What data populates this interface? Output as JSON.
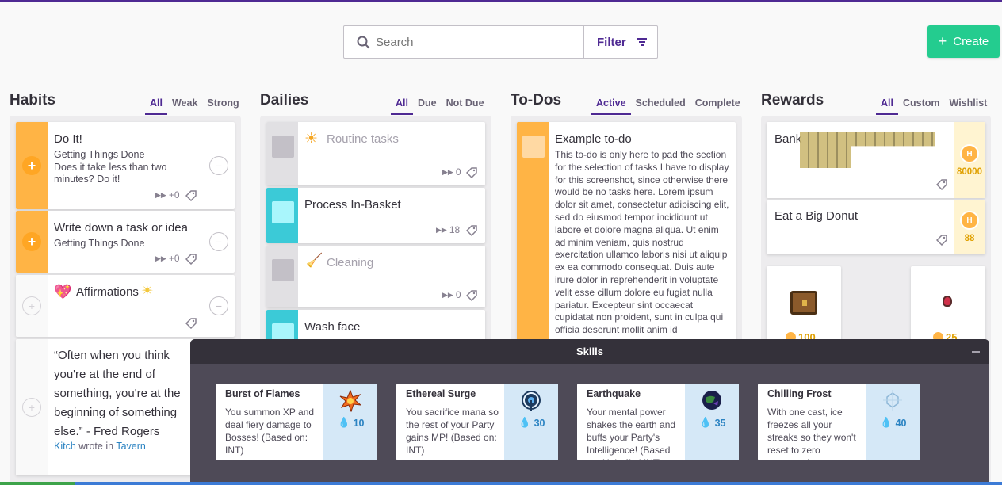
{
  "search": {
    "placeholder": "Search"
  },
  "filter": {
    "label": "Filter"
  },
  "create": {
    "label": "Create"
  },
  "habits": {
    "title": "Habits",
    "tabs": [
      "All",
      "Weak",
      "Strong"
    ],
    "tasks": [
      {
        "title": "Do It!",
        "notes": "Getting Things Done\nDoes it take less than two minutes? Do it!",
        "counter": "+0"
      },
      {
        "title": "Write down a task or idea",
        "notes": "Getting Things Done",
        "counter": "+0"
      },
      {
        "title": "Affirmations",
        "notes": "",
        "counter": ""
      },
      {
        "title": "“Often when you think you're at the end of something, you're at the beginning of something else.” - Fred Rogers",
        "author": "Kitch",
        "wrote_in": "wrote in",
        "location": "Tavern"
      }
    ]
  },
  "dailies": {
    "title": "Dailies",
    "tabs": [
      "All",
      "Due",
      "Not Due"
    ],
    "tasks": [
      {
        "title": "Routine tasks",
        "streak": "0"
      },
      {
        "title": "Process In-Basket",
        "streak": "18"
      },
      {
        "title": "Cleaning",
        "streak": "0"
      },
      {
        "title": "Wash face",
        "streak": ""
      }
    ]
  },
  "todos": {
    "title": "To-Dos",
    "tabs": [
      "Active",
      "Scheduled",
      "Complete"
    ],
    "tasks": [
      {
        "title": "Example to-do",
        "notes": "This to-do is only here to pad the section for the selection of tasks I have to display for this screenshot, since otherwise there would be no tasks here. Lorem ipsum dolor sit amet, consectetur adipiscing elit, sed do eiusmod tempor incididunt ut labore et dolore magna aliqua. Ut enim ad minim veniam, quis nostrud exercitation ullamco laboris nisi ut aliquip ex ea commodo consequat. Duis aute irure dolor in reprehenderit in voluptate velit esse cillum dolore eu fugiat nulla pariatur. Excepteur sint occaecat cupidatat non proident, sunt in culpa qui officia deserunt mollit anim id"
      }
    ]
  },
  "rewards": {
    "title": "Rewards",
    "tabs": [
      "All",
      "Custom",
      "Wishlist"
    ],
    "custom": [
      {
        "title": "Bank",
        "cost": "80000"
      },
      {
        "title": "Eat a Big Donut",
        "cost": "88"
      }
    ],
    "items": [
      {
        "name": "treasure-chest",
        "cost": "100"
      },
      {
        "name": "health-potion",
        "cost": "25"
      }
    ]
  },
  "skills": {
    "title": "Skills",
    "list": [
      {
        "name": "Burst of Flames",
        "desc": "You summon XP and deal fiery damage to Bosses! (Based on: INT)",
        "cost": "10"
      },
      {
        "name": "Ethereal Surge",
        "desc": "You sacrifice mana so the rest of your Party gains MP! (Based on: INT)",
        "cost": "30"
      },
      {
        "name": "Earthquake",
        "desc": "Your mental power shakes the earth and buffs your Party's Intelligence! (Based on: Unbuffed INT)",
        "cost": "35"
      },
      {
        "name": "Chilling Frost",
        "desc": "With one cast, ice freezes all your streaks so they won't reset to zero tomorrow!",
        "cost": "40"
      }
    ]
  },
  "colors": {
    "purple": "#4f2a93",
    "green": "#24cc8f",
    "orange": "#ffb445",
    "teal": "#3bcad7",
    "gold": "#fff4d1"
  }
}
